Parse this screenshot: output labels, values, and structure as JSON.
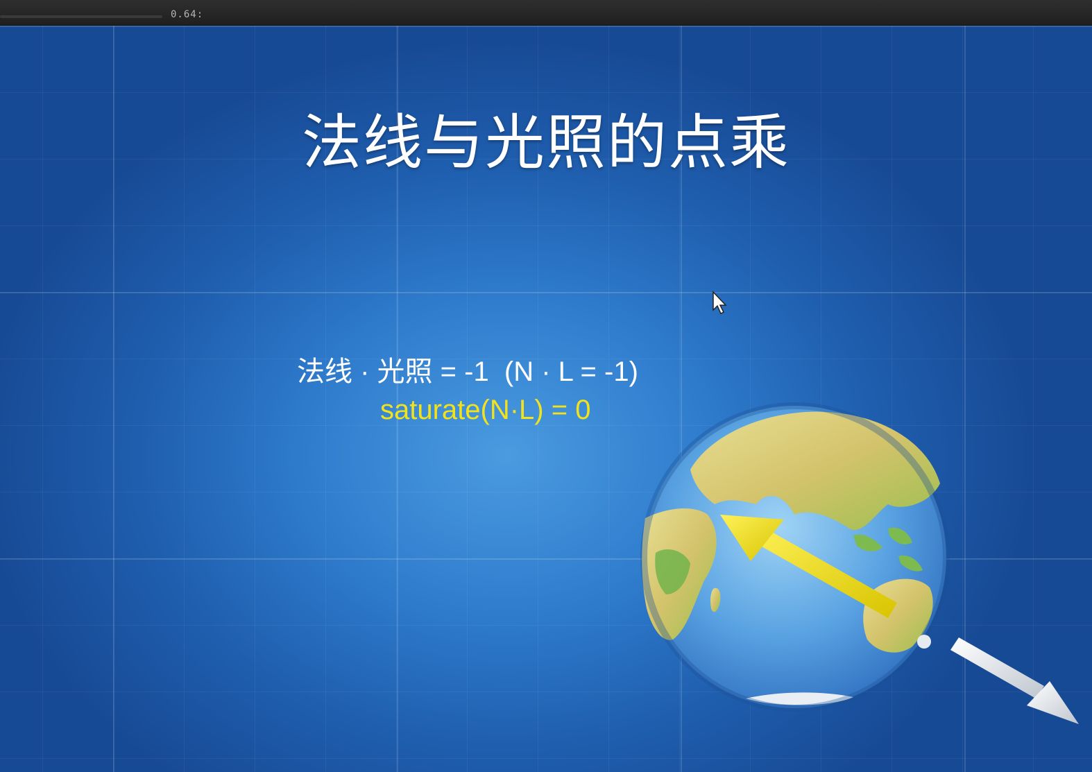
{
  "player": {
    "time_readout": "0.64:",
    "progress_fraction": 0.0
  },
  "slide": {
    "title": "法线与光照的点乘",
    "formula_line": "法线 · 光照 = -1  (N · L = -1)",
    "saturate_line": "saturate(N·L) = 0"
  },
  "colors": {
    "background_blue": "#2f7ccd",
    "normal_arrow": "#f2e21b",
    "light_arrow": "#ffffff",
    "saturate_text": "#f2e21b"
  },
  "icons": {
    "cursor": "mouse-cursor-icon",
    "globe": "earth-globe-icon"
  }
}
